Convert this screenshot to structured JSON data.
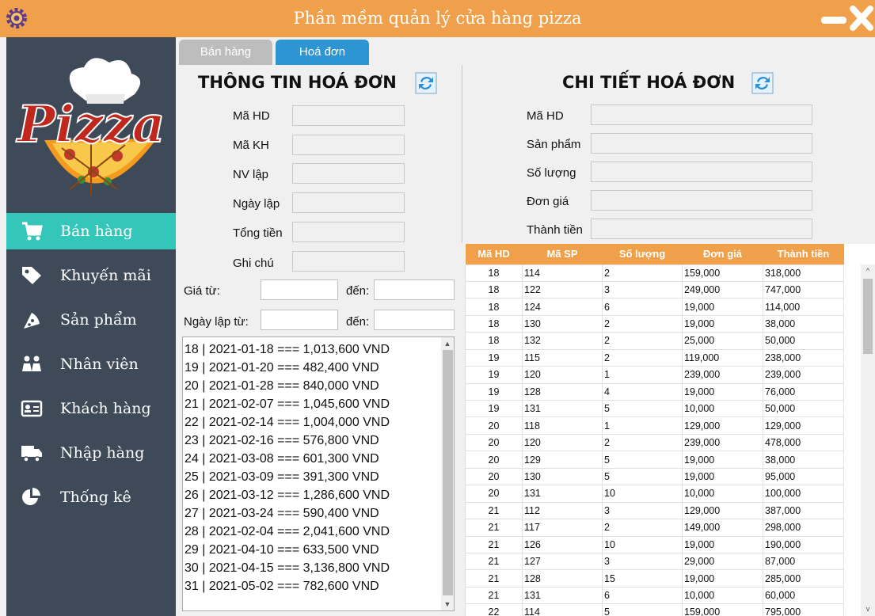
{
  "window": {
    "title": "Phần mềm quản lý cửa hàng pizza",
    "icon": "gear-icon",
    "accent": "#f0a04b"
  },
  "logo": {
    "text": "Pizza",
    "icon": "pizza-chef-logo"
  },
  "sidebar": {
    "items": [
      {
        "label": "Bán hàng",
        "icon": "cart-icon",
        "active": true
      },
      {
        "label": "Khuyến mãi",
        "icon": "tag-icon",
        "active": false
      },
      {
        "label": "Sản phẩm",
        "icon": "pizza-slice-icon",
        "active": false
      },
      {
        "label": "Nhân viên",
        "icon": "staff-icon",
        "active": false
      },
      {
        "label": "Khách hàng",
        "icon": "id-card-icon",
        "active": false
      },
      {
        "label": "Nhập hàng",
        "icon": "truck-icon",
        "active": false
      },
      {
        "label": "Thống kê",
        "icon": "pie-chart-icon",
        "active": false
      }
    ]
  },
  "tabs": [
    {
      "label": "Bán hàng",
      "active": false
    },
    {
      "label": "Hoá đơn",
      "active": true
    }
  ],
  "invoice_info": {
    "title": "THÔNG TIN HOÁ ĐƠN",
    "fields": [
      {
        "label": "Mã HD",
        "value": ""
      },
      {
        "label": "Mã KH",
        "value": ""
      },
      {
        "label": "NV lập",
        "value": ""
      },
      {
        "label": "Ngày lập",
        "value": ""
      },
      {
        "label": "Tổng tiền",
        "value": ""
      },
      {
        "label": "Ghi chú",
        "value": ""
      }
    ],
    "price_from_label": "Giá từ:",
    "price_to_label": "đến:",
    "date_from_label": "Ngày lập từ:",
    "date_to_label": "đến:",
    "price_from": "",
    "price_to": "",
    "date_from": "",
    "date_to": "",
    "list": [
      "18 | 2021-01-18 === 1,013,600 VND",
      "19 | 2021-01-20 === 482,400 VND",
      "20 | 2021-01-28 === 840,000 VND",
      "21 | 2021-02-07 === 1,045,600 VND",
      "22 | 2021-02-14 === 1,004,000 VND",
      "23 | 2021-02-16 === 576,800 VND",
      "24 | 2021-03-08 === 601,300 VND",
      "25 | 2021-03-09 === 391,300 VND",
      "26 | 2021-03-12 === 1,286,600 VND",
      "27 | 2021-03-24 === 590,400 VND",
      "28 | 2021-02-04 === 2,041,600 VND",
      "29 | 2021-04-10 === 633,500 VND",
      "30 | 2021-04-15 === 3,136,800 VND",
      "31 | 2021-05-02 === 782,600 VND"
    ]
  },
  "invoice_detail": {
    "title": "CHI TIẾT HOÁ ĐƠN",
    "fields": [
      {
        "label": "Mã HD",
        "value": ""
      },
      {
        "label": "Sản phẩm",
        "value": ""
      },
      {
        "label": "Số lượng",
        "value": ""
      },
      {
        "label": "Đơn giá",
        "value": ""
      },
      {
        "label": "Thành tiền",
        "value": ""
      }
    ],
    "table": {
      "columns": [
        "Mã HD",
        "Mã SP",
        "Số lượng",
        "Đơn giá",
        "Thành tiền"
      ],
      "rows": [
        [
          "18",
          "114",
          "2",
          "159,000",
          "318,000"
        ],
        [
          "18",
          "122",
          "3",
          "249,000",
          "747,000"
        ],
        [
          "18",
          "124",
          "6",
          "19,000",
          "114,000"
        ],
        [
          "18",
          "130",
          "2",
          "19,000",
          "38,000"
        ],
        [
          "18",
          "132",
          "2",
          "25,000",
          "50,000"
        ],
        [
          "19",
          "115",
          "2",
          "119,000",
          "238,000"
        ],
        [
          "19",
          "120",
          "1",
          "239,000",
          "239,000"
        ],
        [
          "19",
          "128",
          "4",
          "19,000",
          "76,000"
        ],
        [
          "19",
          "131",
          "5",
          "10,000",
          "50,000"
        ],
        [
          "20",
          "118",
          "1",
          "129,000",
          "129,000"
        ],
        [
          "20",
          "120",
          "2",
          "239,000",
          "478,000"
        ],
        [
          "20",
          "129",
          "5",
          "19,000",
          "38,000"
        ],
        [
          "20",
          "130",
          "5",
          "19,000",
          "95,000"
        ],
        [
          "20",
          "131",
          "10",
          "10,000",
          "100,000"
        ],
        [
          "21",
          "112",
          "3",
          "129,000",
          "387,000"
        ],
        [
          "21",
          "117",
          "2",
          "149,000",
          "298,000"
        ],
        [
          "21",
          "126",
          "10",
          "19,000",
          "190,000"
        ],
        [
          "21",
          "127",
          "3",
          "29,000",
          "87,000"
        ],
        [
          "21",
          "128",
          "15",
          "19,000",
          "285,000"
        ],
        [
          "21",
          "131",
          "6",
          "10,000",
          "60,000"
        ],
        [
          "22",
          "114",
          "5",
          "159,000",
          "795,000"
        ]
      ]
    }
  }
}
